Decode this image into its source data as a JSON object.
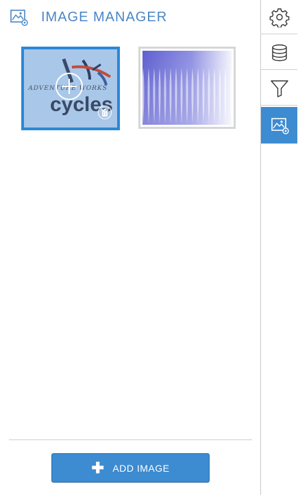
{
  "header": {
    "title": "IMAGE MANAGER",
    "icon": "image-settings-icon"
  },
  "images": [
    {
      "label_line1": "ADVENTURE WORKS",
      "label_line2": "cycles",
      "selected": true,
      "overlay_icon": "plus-circle-icon",
      "delete_icon": "trash-icon"
    },
    {
      "selected": false
    }
  ],
  "footer": {
    "add_image_label": "ADD IMAGE",
    "add_icon": "plus-icon"
  },
  "toolbar": {
    "items": [
      {
        "name": "settings",
        "icon": "gear-icon",
        "active": false
      },
      {
        "name": "data",
        "icon": "database-icon",
        "active": false
      },
      {
        "name": "filter",
        "icon": "filter-icon",
        "active": false
      },
      {
        "name": "image-manager",
        "icon": "image-settings-icon",
        "active": true
      }
    ]
  },
  "colors": {
    "accent": "#3d8bd0",
    "title": "#4a86c5",
    "selected_border": "#2a88d8"
  }
}
